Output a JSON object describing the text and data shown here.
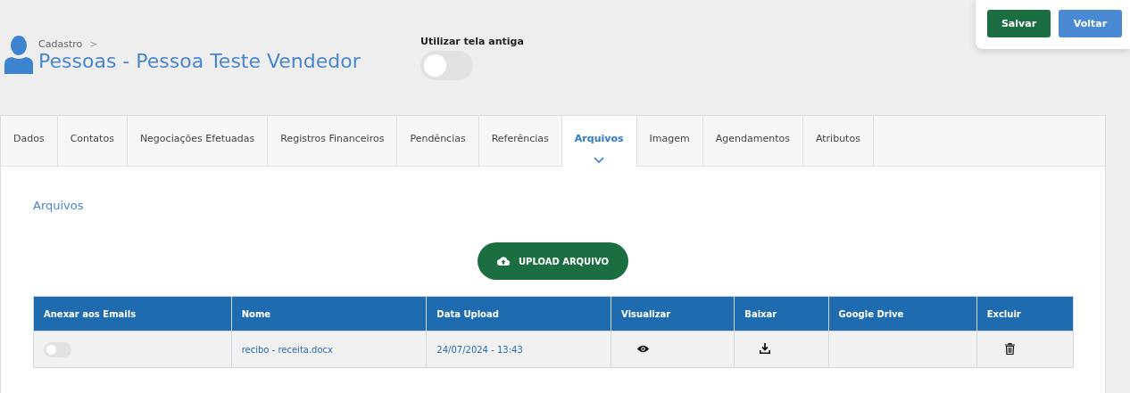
{
  "header": {
    "breadcrumb": "Cadastro",
    "breadcrumb_separator": ">",
    "title": "Pessoas - Pessoa Teste Vendedor"
  },
  "old_screen": {
    "label": "Utilizar tela antiga",
    "on": false
  },
  "actions": [
    {
      "label": "Salvar",
      "kind": "primary"
    },
    {
      "label": "Voltar",
      "kind": "secondary"
    }
  ],
  "tabs": [
    {
      "label": "Dados",
      "selected": false
    },
    {
      "label": "Contatos",
      "selected": false
    },
    {
      "label": "Negociações Efetuadas",
      "selected": false
    },
    {
      "label": "Registros Financeiros",
      "selected": false
    },
    {
      "label": "Pendências",
      "selected": false
    },
    {
      "label": "Referências",
      "selected": false
    },
    {
      "label": "Arquivos",
      "selected": true
    },
    {
      "label": "Imagem",
      "selected": false
    },
    {
      "label": "Agendamentos",
      "selected": false
    },
    {
      "label": "Atributos",
      "selected": false
    }
  ],
  "section_title": "Arquivos",
  "upload_button": "UPLOAD ARQUIVO",
  "table": {
    "columns": [
      "Anexar aos Emails",
      "Nome",
      "Data Upload",
      "Visualizar",
      "Baixar",
      "Google Drive",
      "Excluir"
    ],
    "rows": [
      {
        "attach": false,
        "name": "recibo - receita.docx",
        "date": "24/07/2024 - 13:43"
      }
    ]
  }
}
